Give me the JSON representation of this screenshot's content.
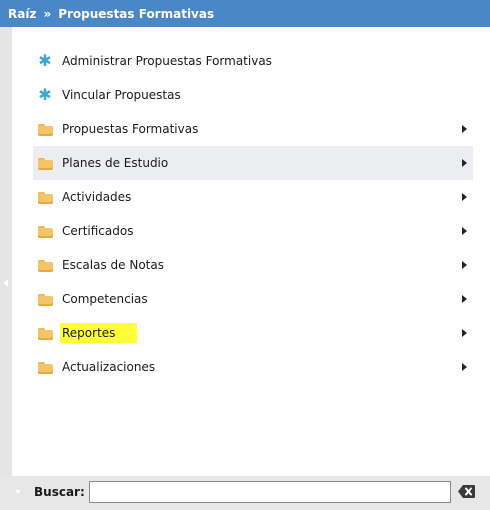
{
  "breadcrumb": {
    "root": "Raíz",
    "separator": "»",
    "current": "Propuestas Formativas"
  },
  "menu": {
    "items": [
      {
        "label": "Administrar Propuestas Formativas",
        "icon": "gear-icon",
        "submenu": false,
        "active": false,
        "highlighted": false
      },
      {
        "label": "Vincular Propuestas",
        "icon": "gear-icon",
        "submenu": false,
        "active": false,
        "highlighted": false
      },
      {
        "label": "Propuestas Formativas",
        "icon": "folder-icon",
        "submenu": true,
        "active": false,
        "highlighted": false
      },
      {
        "label": "Planes de Estudio",
        "icon": "folder-icon",
        "submenu": true,
        "active": true,
        "highlighted": false
      },
      {
        "label": "Actividades",
        "icon": "folder-icon",
        "submenu": true,
        "active": false,
        "highlighted": false
      },
      {
        "label": "Certificados",
        "icon": "folder-icon",
        "submenu": true,
        "active": false,
        "highlighted": false
      },
      {
        "label": "Escalas de Notas",
        "icon": "folder-icon",
        "submenu": true,
        "active": false,
        "highlighted": false
      },
      {
        "label": "Competencias",
        "icon": "folder-icon",
        "submenu": true,
        "active": false,
        "highlighted": false
      },
      {
        "label": "Reportes",
        "icon": "folder-icon",
        "submenu": true,
        "active": false,
        "highlighted": true
      },
      {
        "label": "Actualizaciones",
        "icon": "folder-icon",
        "submenu": true,
        "active": false,
        "highlighted": false
      }
    ]
  },
  "search": {
    "label": "Buscar:",
    "value": "",
    "clear_icon": "clear-icon"
  },
  "colors": {
    "header": "#4a87c8",
    "active_row": "#ecedf1",
    "highlight": "#ffff33",
    "folder": "#f4c46a",
    "gear": "#3aa9d8"
  }
}
